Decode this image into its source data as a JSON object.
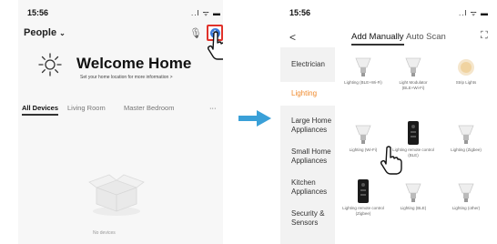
{
  "left_screen": {
    "status_time": "15:56",
    "status_icons": "..l ᯤ ▬",
    "home_selector": "People",
    "welcome_title": "Welcome Home",
    "welcome_subtitle": "Set your home location for more information  >",
    "tabs": [
      "All Devices",
      "Living Room",
      "Master Bedroom",
      "···"
    ],
    "empty_text": "No devices"
  },
  "right_screen": {
    "status_time": "15:56",
    "status_icons": "..l ᯤ ▬",
    "back": "<",
    "tab_manual": "Add Manually",
    "tab_auto": "Auto Scan",
    "categories": [
      {
        "label": "Electrician",
        "active": false
      },
      {
        "label": "Lighting",
        "active": true
      },
      {
        "label": "Large Home Appliances",
        "active": false
      },
      {
        "label": "Small Home Appliances",
        "active": false
      },
      {
        "label": "Kitchen Appliances",
        "active": false
      },
      {
        "label": "Security & Sensors",
        "active": false
      }
    ],
    "products": [
      {
        "label": "Lighting (BLE+Wi-Fi)",
        "icon": "bulb-icon"
      },
      {
        "label": "Light Modulator (BLE+Wi-Fi)",
        "icon": "bulb-icon"
      },
      {
        "label": "Strip Lights",
        "icon": "strip-light-icon"
      },
      {
        "label": "Lighting (Wi-Fi)",
        "icon": "bulb-icon"
      },
      {
        "label": "Lighting remote control (BLE)",
        "icon": "remote-icon"
      },
      {
        "label": "Lighting (Zigbee)",
        "icon": "bulb-icon"
      },
      {
        "label": "Lighting remote control (Zigbee)",
        "icon": "remote-icon"
      },
      {
        "label": "Lighting (BLE)",
        "icon": "bulb-icon"
      },
      {
        "label": "Lighting (other)",
        "icon": "bulb-icon"
      }
    ]
  },
  "colors": {
    "accent_blue": "#3d7bd9",
    "highlight_red": "#e0322b",
    "active_orange": "#f08a2d",
    "arrow_blue": "#3aa0d8"
  }
}
